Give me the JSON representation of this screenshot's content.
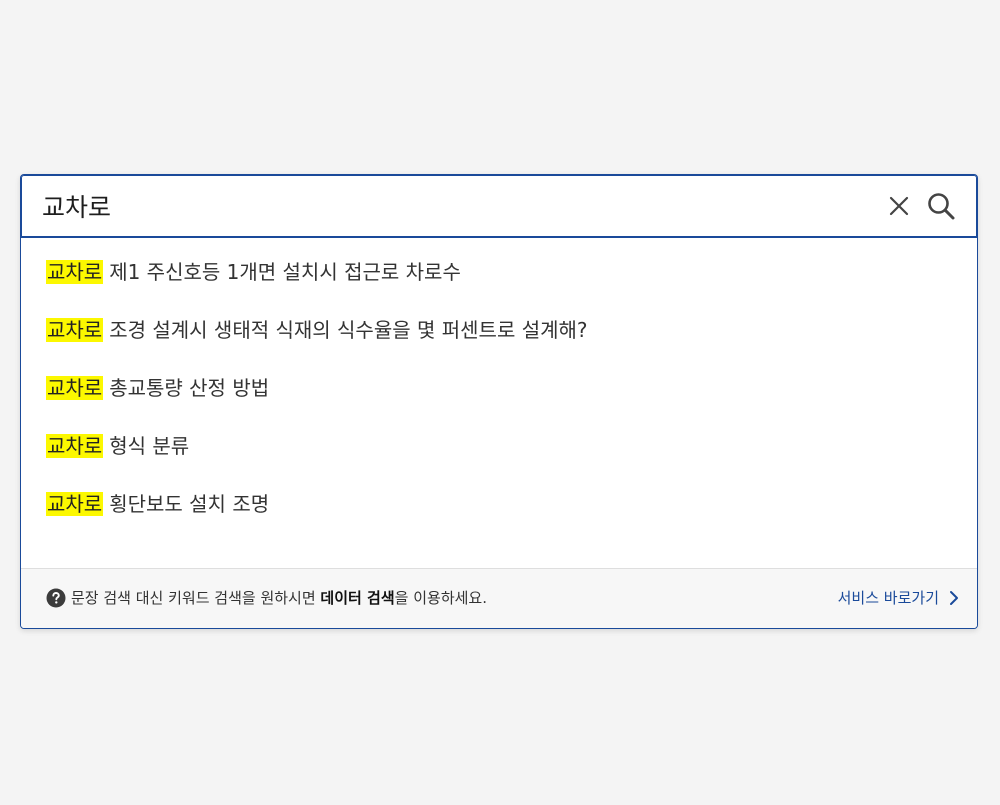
{
  "search": {
    "value": "교차로",
    "placeholder": ""
  },
  "icons": {
    "clear": "close-icon",
    "search": "search-icon",
    "help": "question-circle-icon",
    "link_arrow": "chevron-right-icon"
  },
  "suggestions": [
    {
      "highlight": "교차로",
      "rest": "제1 주신호등 1개면 설치시 접근로 차로수"
    },
    {
      "highlight": "교차로",
      "rest": "조경 설계시 생태적 식재의 식수율을 몇 퍼센트로 설계해?"
    },
    {
      "highlight": "교차로",
      "rest": "총교통량 산정 방법"
    },
    {
      "highlight": "교차로",
      "rest": "형식 분류"
    },
    {
      "highlight": "교차로",
      "rest": "횡단보도 설치 조명"
    }
  ],
  "footer": {
    "text_before": "문장 검색 대신 키워드 검색을 원하시면 ",
    "text_bold": "데이터 검색",
    "text_after": "을 이용하세요.",
    "link_label": "서비스 바로가기"
  },
  "colors": {
    "accent": "#1a4a9a",
    "highlight": "#fcf800",
    "background": "#f4f4f4"
  }
}
